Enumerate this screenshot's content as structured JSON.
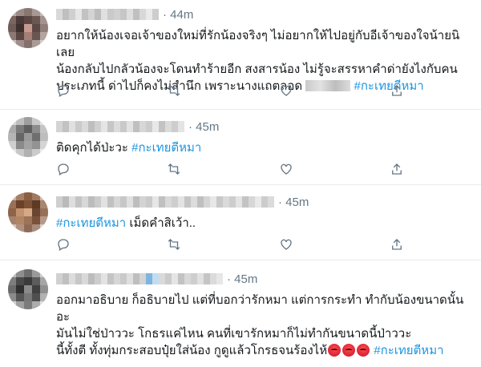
{
  "colors": {
    "hashtag": "#1b95e0",
    "meta": "#657786",
    "divider": "#e6ecf0",
    "icon": "#657786"
  },
  "tweets": [
    {
      "time": "44m",
      "text_lines": [
        "อยากให้น้องเจอเจ้าของใหม่ที่รักน้องจริงๆ ไม่อยากให้ไปอยู่กับอีเจ้าของใจน้ายนิเลย",
        "น้องกลับไปกลัวน้องจะโดนทำร้ายอีก สงสารน้อง ไม่รู้จะสรรหาคำด่ายังไงกับคน",
        "ประเภทนี้ ด่าไปก็คงไม่สำนึก เพราะนางแถตลอด"
      ],
      "hashtag": "#กะเทยตีหมา"
    },
    {
      "time": "45m",
      "text": "ติดคุกได้ป่ะวะ ",
      "hashtag": "#กะเทยตีหมา"
    },
    {
      "time": "45m",
      "hashtag": "#กะเทยตีหมา",
      "text": " เม็ดคำสิเว้า.."
    },
    {
      "time": "45m",
      "text_lines": [
        "ออกมาอธิบาย ก็อธิบายไป แต่ที่บอกว่ารักหมา แต่การกระทำ ทำกับน้องขนาดนั้นอะ",
        "มันไม่ใช่ป่าววะ โกธรแค่ไหน คนที่เขารักหมาก็ไม่ทำกันขนาดนี้ป่าววะ",
        "นี้ทั้งตี ทั้งทุ่มกระสอบปุ๋ยใส่น้อง กูดูแล้วโกรธจนร้องไห้"
      ],
      "hashtag": "#กะเทยตีหมา"
    }
  ],
  "icons": [
    "reply-icon",
    "retweet-icon",
    "like-icon",
    "share-icon"
  ]
}
